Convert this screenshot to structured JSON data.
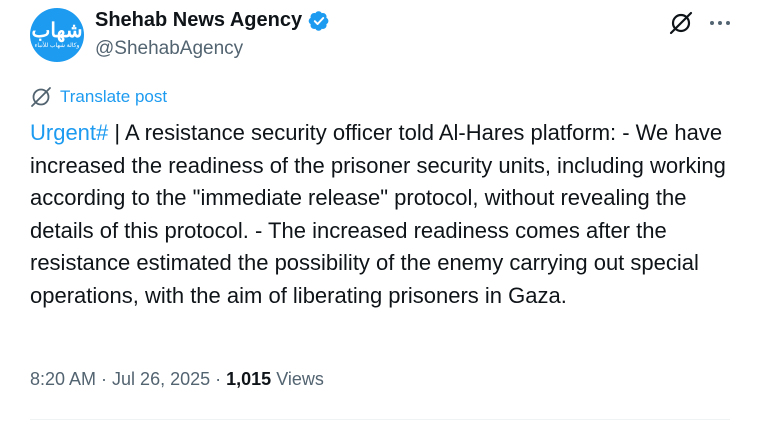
{
  "author": {
    "display_name": "Shehab News Agency",
    "handle": "@ShehabAgency",
    "avatar_text": "شهاب",
    "avatar_subtext": "وكالة شهاب للأنباء"
  },
  "actions": {
    "grok_icon": "grok-icon",
    "more_icon": "more-icon"
  },
  "translate": {
    "label": "Translate post",
    "icon": "translate-icon"
  },
  "post": {
    "hashtag": "Urgent#",
    "body": " | A resistance security officer told Al-Hares platform: - We have increased the readiness of the prisoner security units, including working according to the \"immediate release\" protocol, without revealing the details of this protocol. - The increased readiness comes after the resistance estimated the possibility of the enemy carrying out special operations, with the aim of liberating prisoners in Gaza."
  },
  "meta": {
    "time": "8:20 AM",
    "separator": " · ",
    "date": "Jul 26, 2025",
    "views_count": "1,015",
    "views_label": "Views"
  },
  "colors": {
    "accent": "#1d9bf0",
    "text": "#0f1419",
    "secondary": "#536471"
  }
}
